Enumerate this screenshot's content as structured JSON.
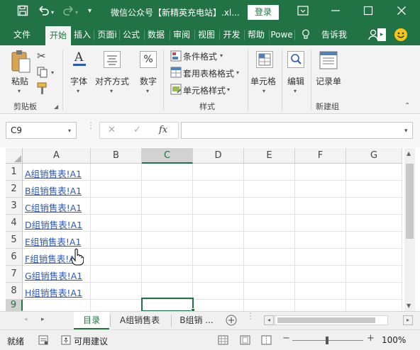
{
  "titlebar": {
    "save_icon": "save-icon",
    "undo_icon": "undo-icon",
    "redo_icon": "redo-icon",
    "qat_icon": "customize-qat-icon",
    "title": "微信公众号【新精英充电站】.xl...",
    "login": "登录",
    "ribbon_display_icon": "ribbon-display-options-icon",
    "minimize_icon": "minimize-icon",
    "restore_icon": "restore-icon",
    "close_icon": "close-icon"
  },
  "tabs": [
    {
      "label": "文件"
    },
    {
      "label": "开始"
    },
    {
      "label": "插入"
    },
    {
      "label": "页面i"
    },
    {
      "label": "公式"
    },
    {
      "label": "数据"
    },
    {
      "label": "审阅"
    },
    {
      "label": "视图"
    },
    {
      "label": "开发"
    },
    {
      "label": "帮助"
    },
    {
      "label": "Powe"
    },
    {
      "label": "告诉我"
    }
  ],
  "active_tab": "开始",
  "ribbon": {
    "paste": "粘贴",
    "clipboard_group": "剪贴板",
    "font": "字体",
    "alignment": "对齐方式",
    "number": "数字",
    "number_symbol": "%",
    "conditional_format": "条件格式",
    "table_format": "套用表格格式",
    "cell_style": "单元格样式",
    "styles_group": "样式",
    "cells": "单元格",
    "editing": "编辑",
    "record": "记录单",
    "new_group": "新建组"
  },
  "formula_bar": {
    "name_box": "C9",
    "cancel": "✕",
    "enter": "✓",
    "fx": "fx",
    "content": ""
  },
  "grid": {
    "columns": [
      "A",
      "B",
      "C",
      "D",
      "E",
      "F",
      "G"
    ],
    "rows": [
      "1",
      "2",
      "3",
      "4",
      "5",
      "6",
      "7",
      "8",
      "9"
    ],
    "selected_cell": "C9",
    "links": [
      "A组销售表!A1",
      "B组销售表!A1",
      "C组销售表!A1",
      "D组销售表!A1",
      "E组销售表!A1",
      "F组销售表!A1",
      "G组销售表!A1",
      "H组销售表!A1"
    ]
  },
  "sheets": {
    "tabs": [
      "目录",
      "A组销售表",
      "B组销 ..."
    ],
    "active": "目录"
  },
  "status": {
    "ready": "就绪",
    "accessibility": "可用建议",
    "zoom": "100%"
  }
}
